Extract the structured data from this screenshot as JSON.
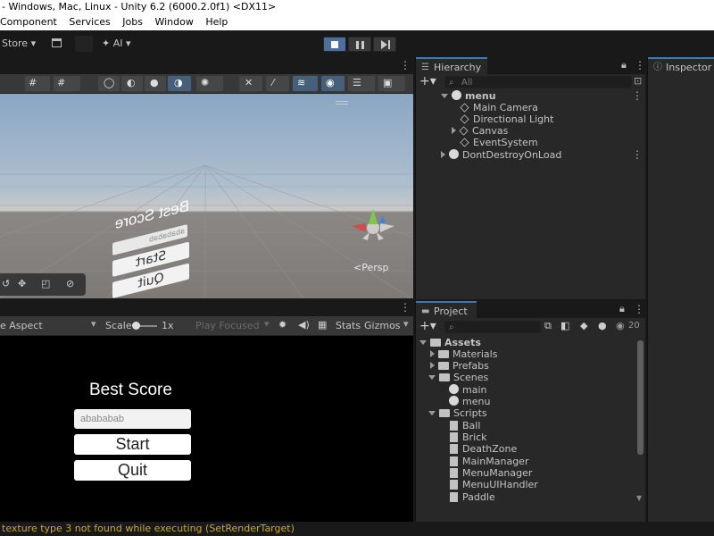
{
  "window": {
    "title": "- Windows, Mac, Linux - Unity 6.2 (6000.2.0f1) <DX11>"
  },
  "menu": [
    "Component",
    "Services",
    "Jobs",
    "Window",
    "Help"
  ],
  "toolbar": {
    "store_label": "Store",
    "ai_label": "AI"
  },
  "scene": {
    "persp_label": "<Persp",
    "world_text": {
      "title": "Best Score",
      "input": "abababab",
      "start": "Start",
      "quit": "Quit"
    }
  },
  "game": {
    "aspect_label": "e Aspect",
    "scale_label": "Scale",
    "scale_value": "1x",
    "play_focused": "Play Focused",
    "stats": "Stats",
    "gizmos": "Gizmos",
    "title": "Best Score",
    "input_value": "abababab",
    "start": "Start",
    "quit": "Quit"
  },
  "hierarchy": {
    "tab": "Hierarchy",
    "search_placeholder": "All",
    "items": [
      {
        "label": "menu"
      },
      {
        "label": "Main Camera"
      },
      {
        "label": "Directional Light"
      },
      {
        "label": "Canvas"
      },
      {
        "label": "EventSystem"
      },
      {
        "label": "DontDestroyOnLoad"
      }
    ]
  },
  "project": {
    "tab": "Project",
    "count": "20",
    "items": [
      {
        "label": "Assets",
        "kind": "folder"
      },
      {
        "label": "Materials",
        "kind": "folder"
      },
      {
        "label": "Prefabs",
        "kind": "folder"
      },
      {
        "label": "Scenes",
        "kind": "folder"
      },
      {
        "label": "main",
        "kind": "scene"
      },
      {
        "label": "menu",
        "kind": "scene"
      },
      {
        "label": "Scripts",
        "kind": "folder"
      },
      {
        "label": "Ball",
        "kind": "script"
      },
      {
        "label": "Brick",
        "kind": "script"
      },
      {
        "label": "DeathZone",
        "kind": "script"
      },
      {
        "label": "MainManager",
        "kind": "script"
      },
      {
        "label": "MenuManager",
        "kind": "script"
      },
      {
        "label": "MenuUIHandler",
        "kind": "script"
      },
      {
        "label": "Paddle",
        "kind": "script"
      }
    ]
  },
  "inspector": {
    "tab": "Inspector"
  },
  "status": {
    "message": "texture type 3 not found while executing  (SetRenderTarget)"
  },
  "colors": {
    "accent": "#3a79bb",
    "status_warning": "#c8a832"
  }
}
